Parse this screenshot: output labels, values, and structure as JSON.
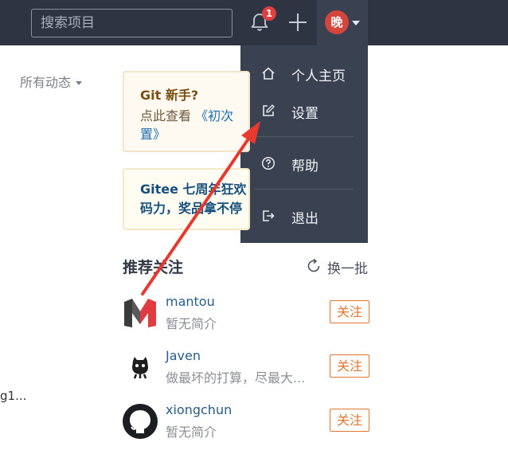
{
  "header": {
    "search_placeholder": "搜索项目",
    "notification_count": "1",
    "avatar_char": "晚"
  },
  "menu": {
    "items": [
      {
        "label": "个人主页",
        "icon": "home-icon"
      },
      {
        "label": "设置",
        "icon": "edit-icon"
      },
      {
        "label": "帮助",
        "icon": "help-circle-icon"
      },
      {
        "label": "退出",
        "icon": "logout-icon"
      }
    ]
  },
  "sidebar": {
    "activity_filter": "所有动态",
    "truncated_text": "g1..."
  },
  "cards": {
    "git_beginner": {
      "title": "Git 新手?",
      "body_prefix": "点此查看",
      "link_text": "《初次",
      "body_suffix": "置》"
    },
    "anniversary": {
      "line1": "Gitee 七周年狂欢",
      "line2": "码力，奖品拿不停"
    }
  },
  "recommend": {
    "title": "推荐关注",
    "refresh_label": "换一批",
    "users": [
      {
        "name": "mantou",
        "bio": "暂无简介",
        "follow_label": "关注"
      },
      {
        "name": "Javen",
        "bio": "做最坏的打算，尽最大...",
        "follow_label": "关注"
      },
      {
        "name": "xiongchun",
        "bio": "暂无简介",
        "follow_label": "关注"
      }
    ]
  },
  "colors": {
    "topbar": "#2e3441",
    "menu_bg": "#3a4150",
    "avatar_bg": "#d4453d",
    "badge": "#e03f3f",
    "follow": "#e0762f",
    "annotation_arrow": "#e8392f"
  }
}
